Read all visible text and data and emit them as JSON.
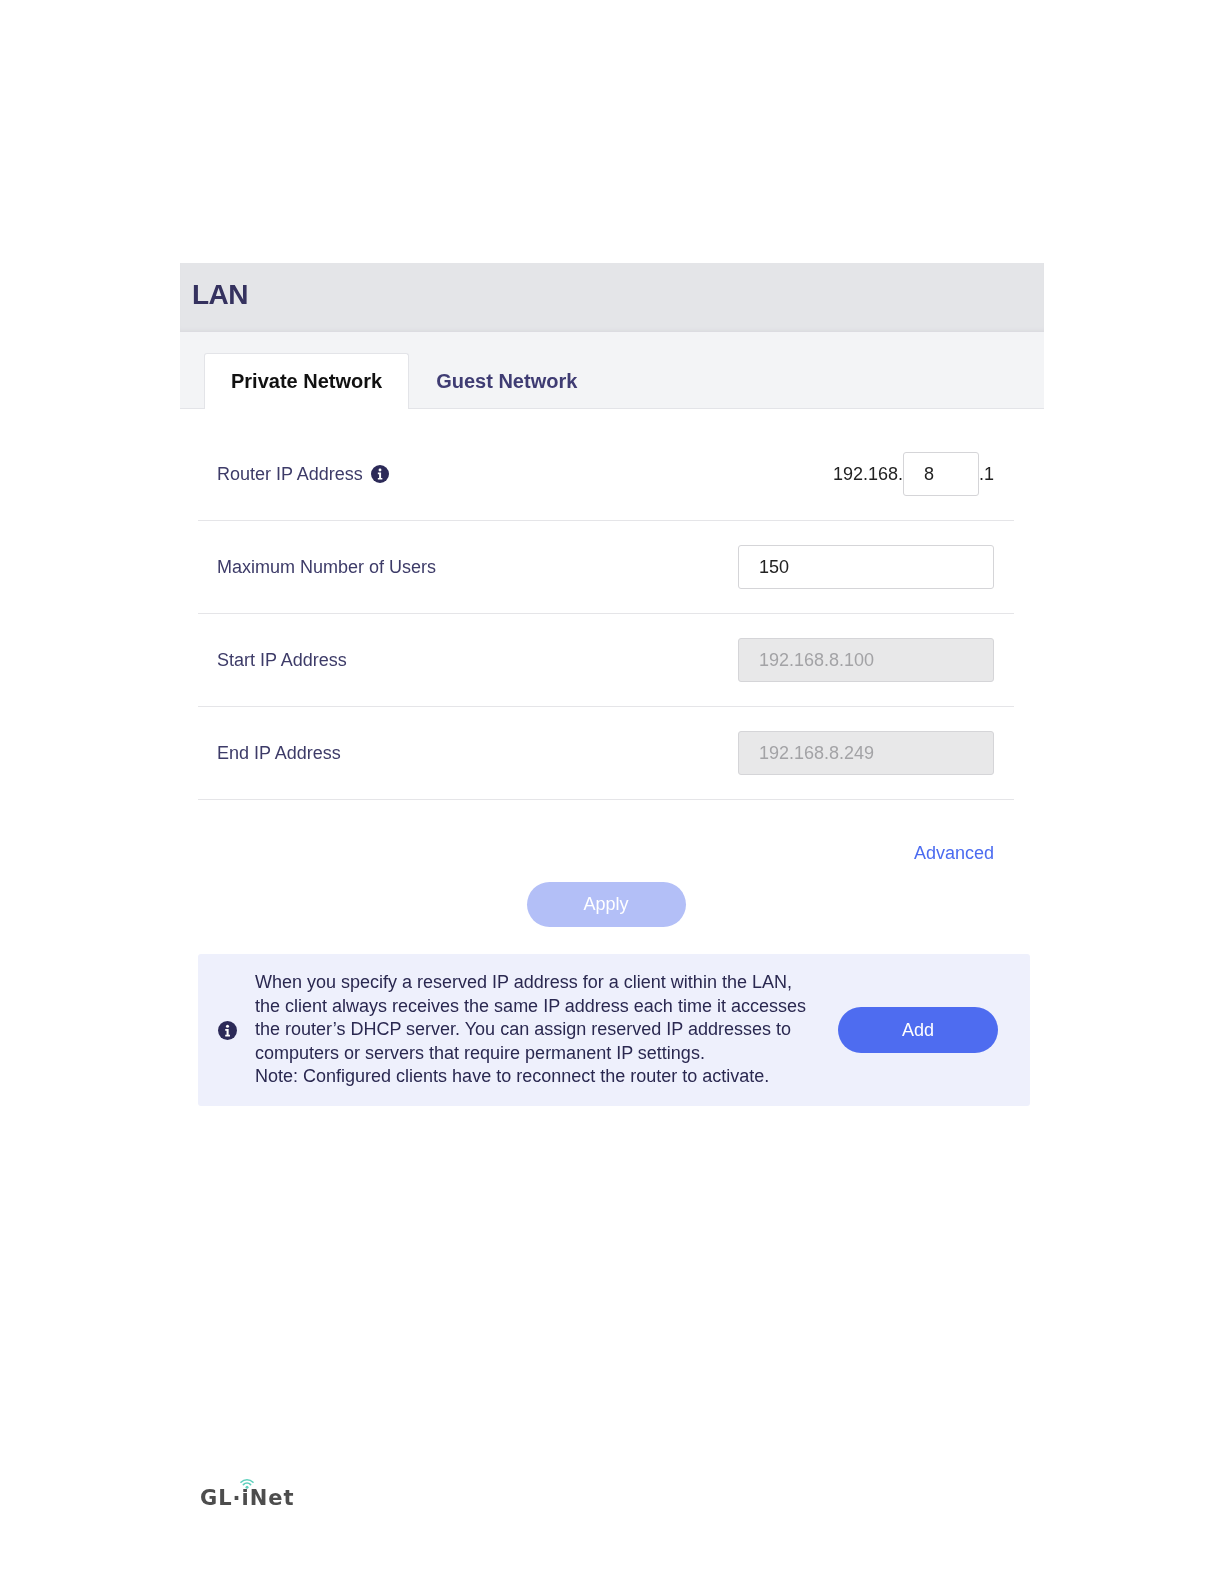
{
  "header": {
    "title": "LAN"
  },
  "tabs": [
    {
      "label": "Private Network",
      "selected": true
    },
    {
      "label": "Guest Network",
      "selected": false
    }
  ],
  "fields": [
    {
      "kind": "ip_octet",
      "label": "Router IP Address",
      "info": true,
      "prefix": "192.168.",
      "value": "8",
      "suffix": ".1"
    },
    {
      "kind": "input",
      "label": "Maximum Number of Users",
      "value": "150",
      "disabled": false
    },
    {
      "kind": "input",
      "label": "Start IP Address",
      "value": "192.168.8.100",
      "disabled": true
    },
    {
      "kind": "input",
      "label": "End IP Address",
      "value": "192.168.8.249",
      "disabled": true
    }
  ],
  "advanced_link": "Advanced",
  "apply_button": {
    "label": "Apply",
    "disabled": true
  },
  "reservation_notice": {
    "text": "When you specify a reserved IP address for a client within the LAN, the client always receives the same IP address each time it accesses the router’s DHCP server. You can assign reserved IP addresses to computers or servers that require permanent IP settings.",
    "note": "Note: Configured clients have to reconnect the router to activate.",
    "button": "Add"
  },
  "footer_logo": "GL·iNet"
}
